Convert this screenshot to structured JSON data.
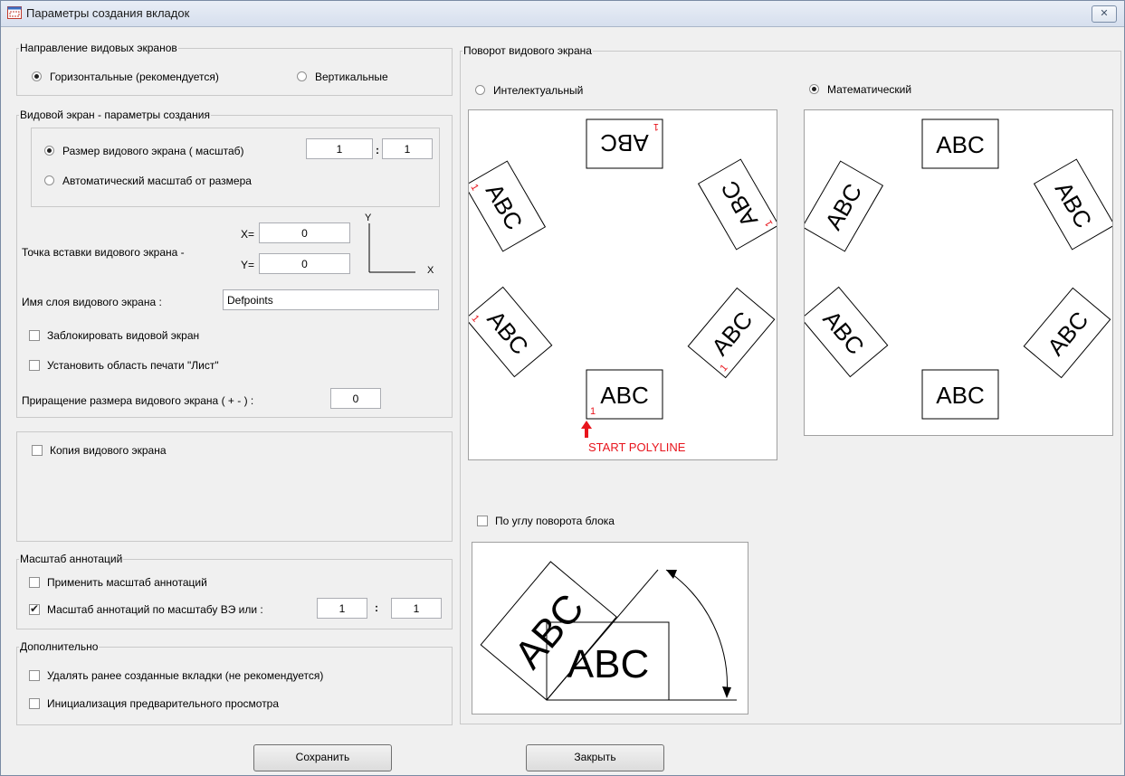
{
  "window": {
    "title": "Параметры создания вкладок",
    "close_glyph": "✕"
  },
  "direction": {
    "legend": "Направление видовых экранов",
    "horizontal": "Горизонтальные (рекомендуется)",
    "vertical": "Вертикальные",
    "selected": "horizontal"
  },
  "create": {
    "legend": "Видовой экран - параметры создания",
    "size_label": "Размер видового экрана ( масштаб)",
    "scale_num": "1",
    "scale_den": "1",
    "colon": ":",
    "auto_label": "Автоматический масштаб от размера",
    "selected": "size"
  },
  "insert": {
    "label": "Точка вставки видового экрана -",
    "x_label": "X=",
    "y_label": "Y=",
    "x_value": "0",
    "y_value": "0",
    "axis_x": "X",
    "axis_y": "Y"
  },
  "layer": {
    "label": "Имя слоя видового экрана :",
    "value": "Defpoints"
  },
  "lock": {
    "label": "Заблокировать видовой экран",
    "checked": false
  },
  "print_area": {
    "label": "Установить область печати \"Лист\"",
    "checked": false
  },
  "increment": {
    "label": "Приращение размера видового экрана ( + - ) :",
    "value": "0"
  },
  "copy": {
    "label": "Копия видового экрана",
    "checked": false
  },
  "annotation": {
    "legend": "Масштаб аннотаций",
    "apply_label": "Применить масштаб аннотаций",
    "apply_checked": false,
    "by_vp_label": "Масштаб аннотаций по масштабу ВЭ или :",
    "by_vp_checked": true,
    "num": "1",
    "den": "1",
    "colon": ":"
  },
  "extra": {
    "legend": "Дополнительно",
    "delete_label": "Удалять ранее созданные вкладки (не рекомендуется)",
    "delete_checked": false,
    "preview_label": "Инициализация предварительного просмотра",
    "preview_checked": false
  },
  "rotation": {
    "legend": "Поворот видового экрана",
    "intel_label": "Интелектуальный",
    "math_label": "Математический",
    "selected": "math",
    "preview_text": "ABC",
    "marker": "1",
    "start_label": "START POLYLINE",
    "block_angle_label": "По углу поворота блока",
    "block_angle_checked": false,
    "accent_color": "#e8141c"
  },
  "buttons": {
    "save": "Сохранить",
    "close": "Закрыть"
  }
}
